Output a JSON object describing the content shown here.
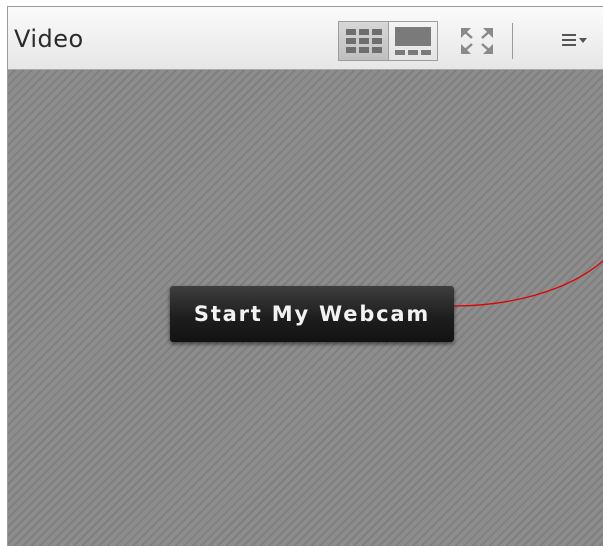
{
  "window": {
    "title": "Video"
  },
  "toolbar": {
    "layout_toggle": {
      "options": [
        "grid-view-icon",
        "single-view-icon"
      ],
      "selected": "grid-view-icon"
    },
    "fullscreen_icon": "fullscreen-icon",
    "menu_icon": "menu-icon"
  },
  "stage": {
    "webcam_button_label": "Start My Webcam"
  },
  "colors": {
    "titlebar": "#eeeeee",
    "stage": "#8a8a8a",
    "button": "#1e1e1e",
    "annotation": "#e00000"
  }
}
